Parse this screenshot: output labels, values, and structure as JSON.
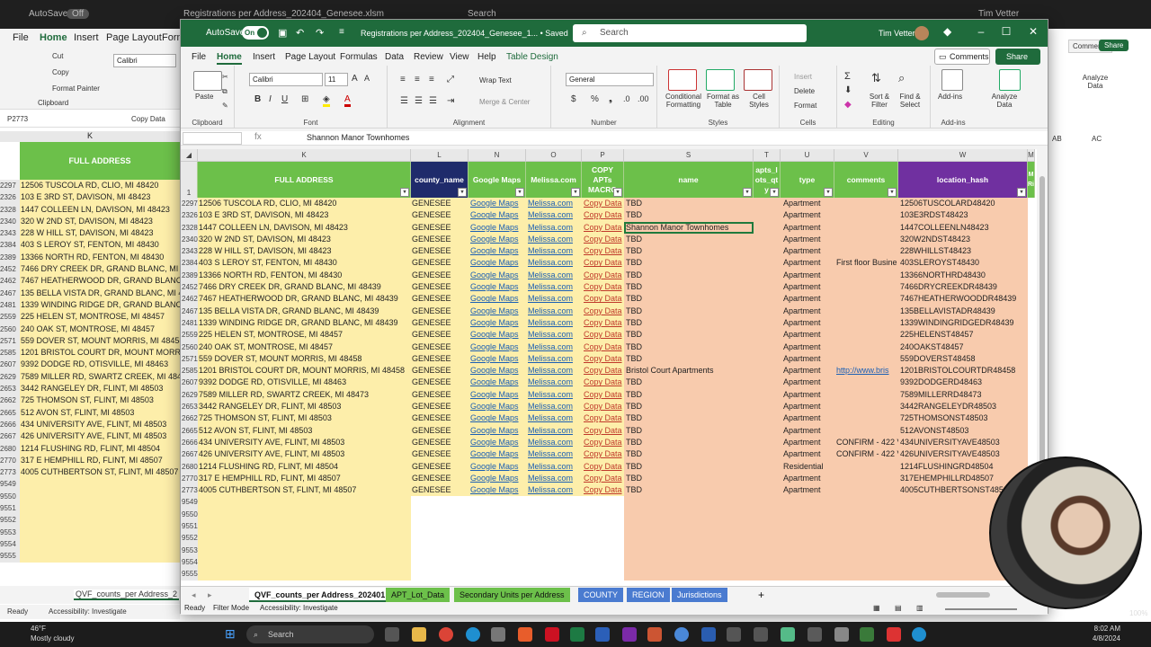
{
  "bg": {
    "autosave": "AutoSave",
    "toggle": "Off",
    "doc": "Registrations per Address_202404_Genesee.xlsm",
    "search": "Search",
    "user": "Tim Vetter",
    "menu": [
      "File",
      "Home",
      "Insert",
      "Page Layout",
      "Form"
    ],
    "cut": "Cut",
    "copy": "Copy",
    "format_painter": "Format Painter",
    "clipboard": "Clipboard",
    "font": "Calibri",
    "namebox": "P2773",
    "formula": "Copy Data",
    "col_k": "K",
    "header": "FULL ADDRESS",
    "comments": "Comments",
    "share": "Share",
    "analyze": "Analyze Data",
    "col_ab": "AB",
    "col_ac": "AC",
    "sheet_tab": "QVF_counts_per Address_2",
    "status": "Ready",
    "accessibility": "Accessibility: Investigate"
  },
  "window": {
    "autosave": "AutoSave",
    "toggle": "On",
    "title": "Registrations per Address_202404_Genesee_1... • Saved",
    "search": "Search",
    "user": "Tim Vetter",
    "menu": [
      "File",
      "Home",
      "Insert",
      "Page Layout",
      "Formulas",
      "Data",
      "Review",
      "View",
      "Help",
      "Table Design"
    ],
    "comments": "Comments",
    "share": "Share"
  },
  "ribbon": {
    "paste": "Paste",
    "clipboard": "Clipboard",
    "font_name": "Calibri",
    "font_size": "11",
    "font": "Font",
    "wrap_text": "Wrap Text",
    "merge_center": "Merge & Center",
    "alignment": "Alignment",
    "number_format": "General",
    "number": "Number",
    "conditional_formatting": "Conditional Formatting",
    "format_as_table": "Format as Table",
    "cell_styles": "Cell Styles",
    "styles": "Styles",
    "insert": "Insert",
    "delete": "Delete",
    "format": "Format",
    "cells": "Cells",
    "sort_filter": "Sort & Filter",
    "find_select": "Find & Select",
    "editing": "Editing",
    "addins": "Add-ins",
    "analyze_data": "Analyze Data",
    "addins_group": "Add-ins"
  },
  "formula_bar": {
    "fx": "fx",
    "value": "Shannon Manor Townhomes"
  },
  "columns": [
    "K",
    "L",
    "N",
    "O",
    "P",
    "S",
    "T",
    "U",
    "V",
    "W",
    "M"
  ],
  "headers": {
    "k": "FULL ADDRESS",
    "l": "county_name",
    "n": "Google Maps",
    "o": "Melissa.com",
    "p": "COPY APTs MACRO",
    "s": "name",
    "t": "apts_l ots_qt y",
    "u": "type",
    "v": "comments",
    "w": "location_hash",
    "x": "M Ri"
  },
  "rows": [
    {
      "rn": "2297",
      "addr": "12506 TUSCOLA RD, CLIO, MI 48420",
      "county": "GENESEE",
      "gm": "Google Maps",
      "mel": "Melissa.com",
      "copy": "Copy Data",
      "name": "TBD",
      "type": "Apartment",
      "comments": "",
      "hash": "12506TUSCOLARD48420"
    },
    {
      "rn": "2326",
      "addr": "103 E 3RD ST, DAVISON, MI 48423",
      "county": "GENESEE",
      "gm": "Google Maps",
      "mel": "Melissa.com",
      "copy": "Copy Data",
      "name": "TBD",
      "type": "Apartment",
      "comments": "",
      "hash": "103E3RDST48423"
    },
    {
      "rn": "2328",
      "addr": "1447 COLLEEN LN, DAVISON, MI 48423",
      "county": "GENESEE",
      "gm": "Google Maps",
      "mel": "Melissa.com",
      "copy": "Copy Data",
      "name": "Shannon Manor Townhomes",
      "type": "Apartment",
      "comments": "",
      "hash": "1447COLLEENLN48423",
      "selected": true
    },
    {
      "rn": "2340",
      "addr": "320 W 2ND ST, DAVISON, MI 48423",
      "county": "GENESEE",
      "gm": "Google Maps",
      "mel": "Melissa.com",
      "copy": "Copy Data",
      "name": "TBD",
      "type": "Apartment",
      "comments": "",
      "hash": "320W2NDST48423"
    },
    {
      "rn": "2343",
      "addr": "228 W HILL ST, DAVISON, MI 48423",
      "county": "GENESEE",
      "gm": "Google Maps",
      "mel": "Melissa.com",
      "copy": "Copy Data",
      "name": "TBD",
      "type": "Apartment",
      "comments": "",
      "hash": "228WHILLST48423"
    },
    {
      "rn": "2384",
      "addr": "403 S LEROY ST, FENTON, MI 48430",
      "county": "GENESEE",
      "gm": "Google Maps",
      "mel": "Melissa.com",
      "copy": "Copy Data",
      "name": "TBD",
      "type": "Apartment",
      "comments": "First floor Busine",
      "hash": "403SLEROYST48430"
    },
    {
      "rn": "2389",
      "addr": "13366 NORTH RD, FENTON, MI 48430",
      "county": "GENESEE",
      "gm": "Google Maps",
      "mel": "Melissa.com",
      "copy": "Copy Data",
      "name": "TBD",
      "type": "Apartment",
      "comments": "",
      "hash": "13366NORTHRD48430"
    },
    {
      "rn": "2452",
      "addr": "7466 DRY CREEK DR, GRAND BLANC, MI 48439",
      "county": "GENESEE",
      "gm": "Google Maps",
      "mel": "Melissa.com",
      "copy": "Copy Data",
      "name": "TBD",
      "type": "Apartment",
      "comments": "",
      "hash": "7466DRYCREEKDR48439"
    },
    {
      "rn": "2462",
      "addr": "7467 HEATHERWOOD DR, GRAND BLANC, MI 48439",
      "county": "GENESEE",
      "gm": "Google Maps",
      "mel": "Melissa.com",
      "copy": "Copy Data",
      "name": "TBD",
      "type": "Apartment",
      "comments": "",
      "hash": "7467HEATHERWOODDR48439"
    },
    {
      "rn": "2467",
      "addr": "135 BELLA VISTA DR, GRAND BLANC, MI 48439",
      "county": "GENESEE",
      "gm": "Google Maps",
      "mel": "Melissa.com",
      "copy": "Copy Data",
      "name": "TBD",
      "type": "Apartment",
      "comments": "",
      "hash": "135BELLAVISTADR48439"
    },
    {
      "rn": "2481",
      "addr": "1339 WINDING RIDGE DR, GRAND BLANC, MI 48439",
      "county": "GENESEE",
      "gm": "Google Maps",
      "mel": "Melissa.com",
      "copy": "Copy Data",
      "name": "TBD",
      "type": "Apartment",
      "comments": "",
      "hash": "1339WINDINGRIDGEDR48439"
    },
    {
      "rn": "2559",
      "addr": "225 HELEN ST, MONTROSE, MI 48457",
      "county": "GENESEE",
      "gm": "Google Maps",
      "mel": "Melissa.com",
      "copy": "Copy Data",
      "name": "TBD",
      "type": "Apartment",
      "comments": "",
      "hash": "225HELENST48457"
    },
    {
      "rn": "2560",
      "addr": "240 OAK ST, MONTROSE, MI 48457",
      "county": "GENESEE",
      "gm": "Google Maps",
      "mel": "Melissa.com",
      "copy": "Copy Data",
      "name": "TBD",
      "type": "Apartment",
      "comments": "",
      "hash": "240OAKST48457"
    },
    {
      "rn": "2571",
      "addr": "559 DOVER ST, MOUNT MORRIS, MI 48458",
      "county": "GENESEE",
      "gm": "Google Maps",
      "mel": "Melissa.com",
      "copy": "Copy Data",
      "name": "TBD",
      "type": "Apartment",
      "comments": "",
      "hash": "559DOVERST48458"
    },
    {
      "rn": "2585",
      "addr": "1201 BRISTOL COURT DR, MOUNT MORRIS, MI 48458",
      "county": "GENESEE",
      "gm": "Google Maps",
      "mel": "Melissa.com",
      "copy": "Copy Data",
      "name": "Bristol Court Apartments",
      "type": "Apartment",
      "comments": "http://www.bris",
      "hash": "1201BRISTOLCOURTDR48458",
      "link": true
    },
    {
      "rn": "2607",
      "addr": "9392 DODGE RD, OTISVILLE, MI 48463",
      "county": "GENESEE",
      "gm": "Google Maps",
      "mel": "Melissa.com",
      "copy": "Copy Data",
      "name": "TBD",
      "type": "Apartment",
      "comments": "",
      "hash": "9392DODGERD48463"
    },
    {
      "rn": "2629",
      "addr": "7589 MILLER RD, SWARTZ CREEK, MI 48473",
      "county": "GENESEE",
      "gm": "Google Maps",
      "mel": "Melissa.com",
      "copy": "Copy Data",
      "name": "TBD",
      "type": "Apartment",
      "comments": "",
      "hash": "7589MILLERRD48473"
    },
    {
      "rn": "2653",
      "addr": "3442 RANGELEY DR, FLINT, MI 48503",
      "county": "GENESEE",
      "gm": "Google Maps",
      "mel": "Melissa.com",
      "copy": "Copy Data",
      "name": "TBD",
      "type": "Apartment",
      "comments": "",
      "hash": "3442RANGELEYDR48503"
    },
    {
      "rn": "2662",
      "addr": "725 THOMSON ST, FLINT, MI 48503",
      "county": "GENESEE",
      "gm": "Google Maps",
      "mel": "Melissa.com",
      "copy": "Copy Data",
      "name": "TBD",
      "type": "Apartment",
      "comments": "",
      "hash": "725THOMSONST48503"
    },
    {
      "rn": "2665",
      "addr": "512 AVON ST, FLINT, MI 48503",
      "county": "GENESEE",
      "gm": "Google Maps",
      "mel": "Melissa.com",
      "copy": "Copy Data",
      "name": "TBD",
      "type": "Apartment",
      "comments": "",
      "hash": "512AVONST48503"
    },
    {
      "rn": "2666",
      "addr": "434 UNIVERSITY AVE, FLINT, MI 48503",
      "county": "GENESEE",
      "gm": "Google Maps",
      "mel": "Melissa.com",
      "copy": "Copy Data",
      "name": "TBD",
      "type": "Apartment",
      "comments": "CONFIRM - 422 V",
      "hash": "434UNIVERSITYAVE48503"
    },
    {
      "rn": "2667",
      "addr": "426 UNIVERSITY AVE, FLINT, MI 48503",
      "county": "GENESEE",
      "gm": "Google Maps",
      "mel": "Melissa.com",
      "copy": "Copy Data",
      "name": "TBD",
      "type": "Apartment",
      "comments": "CONFIRM - 422 V",
      "hash": "426UNIVERSITYAVE48503"
    },
    {
      "rn": "2680",
      "addr": "1214 FLUSHING RD, FLINT, MI 48504",
      "county": "GENESEE",
      "gm": "Google Maps",
      "mel": "Melissa.com",
      "copy": "Copy Data",
      "name": "TBD",
      "type": "Residential",
      "comments": "",
      "hash": "1214FLUSHINGRD48504"
    },
    {
      "rn": "2770",
      "addr": "317 E HEMPHILL RD, FLINT, MI 48507",
      "county": "GENESEE",
      "gm": "Google Maps",
      "mel": "Melissa.com",
      "copy": "Copy Data",
      "name": "TBD",
      "type": "Apartment",
      "comments": "",
      "hash": "317EHEMPHILLRD48507"
    },
    {
      "rn": "2773",
      "addr": "4005 CUTHBERTSON ST, FLINT, MI 48507",
      "county": "GENESEE",
      "gm": "Google Maps",
      "mel": "Melissa.com",
      "copy": "Copy Data",
      "name": "TBD",
      "type": "Apartment",
      "comments": "",
      "hash": "4005CUTHBERTSONST48507"
    }
  ],
  "empty_rows": [
    "9549",
    "9550",
    "9551",
    "9552",
    "9553",
    "9554",
    "9555"
  ],
  "sheet_tabs": [
    {
      "label": "QVF_counts_per Address_202401",
      "color": "#ffffff"
    },
    {
      "label": "APT_Lot_Data",
      "color": "#6cc04a"
    },
    {
      "label": "Secondary Units per Address",
      "color": "#6cc04a"
    },
    {
      "label": "COUNTY",
      "color": "#4a7bd0"
    },
    {
      "label": "REGION",
      "color": "#4a7bd0"
    },
    {
      "label": "Jurisdictions",
      "color": "#4a7bd0"
    }
  ],
  "status": {
    "ready": "Ready",
    "filter_mode": "Filter Mode",
    "accessibility": "Accessibility: Investigate"
  },
  "taskbar": {
    "temp": "46°F",
    "weather": "Mostly cloudy",
    "search": "Search",
    "time": "8:02 AM",
    "date": "4/8/2024",
    "zoom": "100%"
  }
}
